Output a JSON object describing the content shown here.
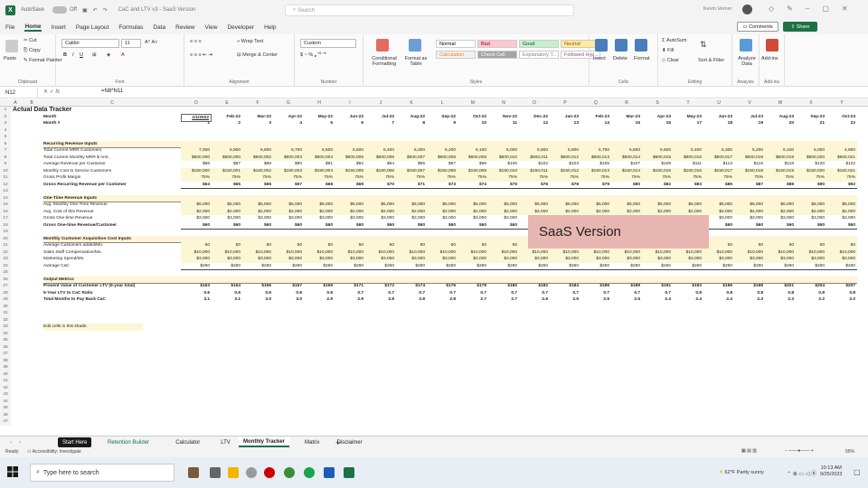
{
  "titlebar": {
    "autosave": "AutoSave",
    "autosave_state": "Off",
    "filename": "CaC and LTV v3 - SaaS Version",
    "search_placeholder": "Search",
    "user_name": "Kevin Verner"
  },
  "menu": [
    "File",
    "Home",
    "Insert",
    "Page Layout",
    "Formulas",
    "Data",
    "Review",
    "View",
    "Developer",
    "Help"
  ],
  "menu_active": "Home",
  "buttons": {
    "comments": "Comments",
    "share": "Share"
  },
  "ribbon": {
    "clipboard": {
      "paste": "Paste",
      "cut": "Cut",
      "copy": "Copy",
      "format_painter": "Format Painter",
      "label": "Clipboard"
    },
    "font": {
      "name": "Calibri",
      "size": "11",
      "label": "Font"
    },
    "alignment": {
      "wrap": "Wrap Text",
      "merge": "Merge & Center",
      "label": "Alignment"
    },
    "number": {
      "format": "Custom",
      "label": "Number"
    },
    "styles": {
      "cond": "Conditional Formatting",
      "table": "Format as Table",
      "label": "Styles",
      "cells": [
        {
          "t": "Normal",
          "bg": "#ffffff",
          "fg": "#000000"
        },
        {
          "t": "Bad",
          "bg": "#ffc7ce",
          "fg": "#9c0006"
        },
        {
          "t": "Good",
          "bg": "#c6efce",
          "fg": "#006100"
        },
        {
          "t": "Neutral",
          "bg": "#ffeb9c",
          "fg": "#9c5700"
        },
        {
          "t": "Calculation",
          "bg": "#f2f2f2",
          "fg": "#fa7d00"
        },
        {
          "t": "Check Cell",
          "bg": "#a5a5a5",
          "fg": "#ffffff"
        },
        {
          "t": "Explanatory T...",
          "bg": "#ffffff",
          "fg": "#7f7f7f"
        },
        {
          "t": "Followed Hyp...",
          "bg": "#ffffff",
          "fg": "#954f72"
        }
      ]
    },
    "cells": {
      "insert": "Insert",
      "delete": "Delete",
      "format": "Format",
      "label": "Cells"
    },
    "editing": {
      "autosum": "AutoSum",
      "fill": "Fill",
      "clear": "Clear",
      "sort": "Sort & Filter",
      "find": "Find & Select",
      "label": "Editing"
    },
    "analysis": {
      "analyze": "Analyze Data",
      "label": "Analysis"
    },
    "addins": {
      "addins": "Add-ins",
      "label": "Add-ins"
    }
  },
  "formula_bar": {
    "cell": "N12",
    "formula": "=N8*N11",
    "fx": "fx"
  },
  "columns": [
    "A",
    "B",
    "C",
    "D",
    "E",
    "F",
    "G",
    "H",
    "I",
    "J",
    "K",
    "L",
    "M",
    "N",
    "O",
    "P",
    "Q",
    "R",
    "S",
    "T",
    "U",
    "V",
    "W",
    "X",
    "Y"
  ],
  "sheet": {
    "title": "Actual Data Tracker",
    "months": [
      "1/1/2022",
      "Feb-22",
      "Mar-22",
      "Apr-22",
      "May-22",
      "Jun-22",
      "Jul-22",
      "Aug-22",
      "Sep-22",
      "Oct-22",
      "Nov-22",
      "Dec-22",
      "Jan-23",
      "Feb-23",
      "Mar-23",
      "Apr-23",
      "May-23",
      "Jun-23",
      "Jul-23",
      "Aug-23",
      "Sep-23",
      "Oct-23"
    ],
    "month_nums": [
      "1",
      "2",
      "3",
      "4",
      "5",
      "6",
      "7",
      "8",
      "9",
      "10",
      "11",
      "12",
      "13",
      "14",
      "15",
      "16",
      "17",
      "18",
      "19",
      "20",
      "21",
      "22"
    ],
    "rows": [
      {
        "r": "1",
        "label": "Actual Data Tracker",
        "style": "title"
      },
      {
        "r": "2",
        "label": "Month",
        "style": "bold",
        "key": "months"
      },
      {
        "r": "3",
        "label": "Month #",
        "style": "bold",
        "key": "month_nums"
      },
      {
        "r": "4"
      },
      {
        "r": "5"
      },
      {
        "r": "6",
        "label": "Recurring Revenue Inputs",
        "style": "section"
      },
      {
        "r": "7",
        "label": "Total Current MRR Customers",
        "vals": [
          "7,000",
          "6,900",
          "6,800",
          "6,700",
          "6,600",
          "6,500",
          "6,400",
          "6,300",
          "6,200",
          "6,100",
          "6,000",
          "5,900",
          "5,800",
          "5,700",
          "5,600",
          "5,500",
          "5,400",
          "5,300",
          "5,200",
          "5,100",
          "5,000",
          "4,900"
        ]
      },
      {
        "r": "8",
        "label": "Total Current Monthly MRR $ Amt.",
        "vals": [
          "$600,000",
          "$600,000",
          "$600,002",
          "$600,003",
          "$600,004",
          "$600,005",
          "$600,006",
          "$600,007",
          "$600,008",
          "$600,009",
          "$600,010",
          "$600,011",
          "$600,012",
          "$600,013",
          "$600,014",
          "$600,015",
          "$600,016",
          "$600,017",
          "$600,018",
          "$600,019",
          "$600,020",
          "$600,021"
        ]
      },
      {
        "r": "9",
        "label": "Average Revenue per Customer",
        "vals": [
          "$86",
          "$87",
          "$88",
          "$90",
          "$91",
          "$92",
          "$94",
          "$95",
          "$97",
          "$98",
          "$100",
          "$102",
          "$103",
          "$105",
          "$107",
          "$109",
          "$111",
          "$113",
          "$115",
          "$118",
          "$120",
          "$122"
        ]
      },
      {
        "r": "10",
        "label": "Monthly Cost to Service Customers",
        "vals": [
          "$150,000",
          "$150,001",
          "$150,002",
          "$150,003",
          "$150,004",
          "$150,005",
          "$150,006",
          "$150,007",
          "$150,008",
          "$150,009",
          "$150,010",
          "$150,011",
          "$150,012",
          "$150,013",
          "$150,014",
          "$150,015",
          "$150,016",
          "$150,017",
          "$150,018",
          "$150,019",
          "$150,020",
          "$150,021"
        ]
      },
      {
        "r": "11",
        "label": "Gross Profit Margin",
        "vals": [
          "75%",
          "75%",
          "75%",
          "75%",
          "75%",
          "75%",
          "75%",
          "75%",
          "75%",
          "75%",
          "75%",
          "75%",
          "75%",
          "75%",
          "75%",
          "75%",
          "75%",
          "75%",
          "75%",
          "75%",
          "75%",
          "75%"
        ]
      },
      {
        "r": "12",
        "label": "Gross Recurring Revenue per Customer",
        "style": "bold",
        "vals": [
          "$64",
          "$65",
          "$66",
          "$67",
          "$68",
          "$69",
          "$70",
          "$71",
          "$73",
          "$74",
          "$75",
          "$76",
          "$78",
          "$79",
          "$80",
          "$82",
          "$83",
          "$85",
          "$87",
          "$88",
          "$90",
          "$92"
        ]
      },
      {
        "r": "13"
      },
      {
        "r": "14",
        "label": "One-Time Revenue Inputs",
        "style": "section"
      },
      {
        "r": "15",
        "label": "Avg. Monthly One-Time Revenue",
        "vals": [
          "$5,000",
          "$5,000",
          "$5,000",
          "$5,000",
          "$5,000",
          "$5,000",
          "$5,000",
          "$5,000",
          "$5,000",
          "$5,000",
          "$5,000",
          "$5,000",
          "$5,000",
          "$5,000",
          "$5,000",
          "$5,000",
          "$5,000",
          "$5,000",
          "$5,000",
          "$5,000",
          "$5,000",
          "$5,000"
        ]
      },
      {
        "r": "16",
        "label": "Avg. Cost of this Revenue",
        "vals": [
          "$2,000",
          "$2,000",
          "$2,000",
          "$2,000",
          "$2,000",
          "$2,000",
          "$2,000",
          "$2,000",
          "$2,000",
          "$2,000",
          "$2,000",
          "$2,000",
          "$2,000",
          "$2,000",
          "$2,000",
          "$2,000",
          "$2,000",
          "$2,000",
          "$2,000",
          "$2,000",
          "$2,000",
          "$2,000"
        ]
      },
      {
        "r": "17",
        "label": "Gross One-time Revenue",
        "vals": [
          "$3,000",
          "$3,000",
          "$3,000",
          "$3,000",
          "$3,000",
          "$3,000",
          "$3,000",
          "$3,000",
          "$3,000",
          "$3,000",
          "$3,000",
          "$3,000",
          "$3,000",
          "$3,000",
          "$3,000",
          "$3,000",
          "$3,000",
          "$3,000",
          "$3,000",
          "$3,000",
          "$3,000",
          "$3,000"
        ]
      },
      {
        "r": "18",
        "label": "Gross One-time Revenue/Customer",
        "style": "bold",
        "vals": [
          "$60",
          "$60",
          "$60",
          "$60",
          "$60",
          "$60",
          "$60",
          "$60",
          "$60",
          "$60",
          "$60",
          "$60",
          "$60",
          "$60",
          "$60",
          "$60",
          "$60",
          "$60",
          "$60",
          "$60",
          "$60",
          "$60"
        ]
      },
      {
        "r": "19"
      },
      {
        "r": "20",
        "label": "Monthly Customer Acquisition Cost Inputs",
        "style": "section"
      },
      {
        "r": "21",
        "label": "Average Customers added/Mo.",
        "vals": [
          "50",
          "50",
          "50",
          "50",
          "50",
          "50",
          "50",
          "50",
          "50",
          "50",
          "50",
          "50",
          "50",
          "50",
          "50",
          "50",
          "50",
          "50",
          "50",
          "50",
          "50",
          "50"
        ]
      },
      {
        "r": "22",
        "label": "Sales Staff Compensation/Mo.",
        "vals": [
          "$10,000",
          "$10,000",
          "$10,000",
          "$10,000",
          "$10,000",
          "$10,000",
          "$10,000",
          "$10,000",
          "$10,000",
          "$10,000",
          "$10,000",
          "$10,000",
          "$10,000",
          "$10,000",
          "$10,000",
          "$10,000",
          "$10,000",
          "$10,000",
          "$10,000",
          "$10,000",
          "$10,000",
          "$10,000"
        ]
      },
      {
        "r": "23",
        "label": "Marketing Spend/Mo.",
        "vals": [
          "$3,000",
          "$3,000",
          "$3,000",
          "$3,000",
          "$3,000",
          "$3,000",
          "$3,000",
          "$3,000",
          "$3,000",
          "$3,000",
          "$3,000",
          "$3,000",
          "$3,000",
          "$3,000",
          "$3,000",
          "$3,000",
          "$3,000",
          "$3,000",
          "$3,000",
          "$3,000",
          "$3,000",
          "$3,000"
        ]
      },
      {
        "r": "24",
        "label": "Average CaC",
        "vals": [
          "$260",
          "$260",
          "$260",
          "$260",
          "$260",
          "$260",
          "$260",
          "$260",
          "$260",
          "$260",
          "$260",
          "$260",
          "$260",
          "$260",
          "$260",
          "$260",
          "$260",
          "$260",
          "$260",
          "$260",
          "$260",
          "$260"
        ]
      },
      {
        "r": "25"
      },
      {
        "r": "26",
        "label": "Output Metrics",
        "style": "section"
      },
      {
        "r": "27",
        "label": "Present Value of Customer LTV (5-year total)",
        "style": "bold",
        "vals": [
          "$163",
          "$164",
          "$166",
          "$167",
          "$169",
          "$171",
          "$172",
          "$174",
          "$176",
          "$178",
          "$180",
          "$182",
          "$184",
          "$186",
          "$189",
          "$191",
          "$193",
          "$196",
          "$198",
          "$201",
          "$204",
          "$207"
        ]
      },
      {
        "r": "28",
        "label": "5-Year LTV to CaC Ratio",
        "style": "bold",
        "vals": [
          "0.6",
          "0.6",
          "0.6",
          "0.6",
          "0.6",
          "0.7",
          "0.7",
          "0.7",
          "0.7",
          "0.7",
          "0.7",
          "0.7",
          "0.7",
          "0.7",
          "0.7",
          "0.7",
          "0.8",
          "0.8",
          "0.8",
          "0.8",
          "0.8",
          "0.8"
        ]
      },
      {
        "r": "29",
        "label": "Total Months to Pay Back CaC",
        "style": "bold",
        "vals": [
          "3.1",
          "3.1",
          "3.0",
          "3.0",
          "2.9",
          "2.9",
          "2.8",
          "2.8",
          "2.8",
          "2.7",
          "2.7",
          "2.6",
          "2.6",
          "2.5",
          "2.5",
          "2.4",
          "2.4",
          "2.4",
          "2.3",
          "2.3",
          "2.2",
          "2.2"
        ]
      },
      {
        "r": "30"
      },
      {
        "r": "31"
      },
      {
        "r": "32"
      },
      {
        "r": "33",
        "label": "Edit cells in this shade.",
        "style": "note"
      },
      {
        "r": "34"
      },
      {
        "r": "35"
      },
      {
        "r": "36"
      },
      {
        "r": "37"
      },
      {
        "r": "38"
      },
      {
        "r": "39"
      },
      {
        "r": "40"
      },
      {
        "r": "41"
      },
      {
        "r": "42"
      },
      {
        "r": "43"
      },
      {
        "r": "44"
      },
      {
        "r": "45"
      },
      {
        "r": "46"
      },
      {
        "r": "47"
      }
    ]
  },
  "overlay": "SaaS Version",
  "tabs": [
    {
      "t": "Start Here",
      "style": "dark"
    },
    {
      "t": "Retention Builder",
      "style": "green"
    },
    {
      "t": "Calculator",
      "style": ""
    },
    {
      "t": "LTV",
      "style": ""
    },
    {
      "t": "Monthly Tracker",
      "style": "active"
    },
    {
      "t": "Matrix",
      "style": ""
    },
    {
      "t": "Disclaimer",
      "style": ""
    }
  ],
  "status": {
    "ready": "Ready",
    "accessibility": "Accessibility: Investigate",
    "zoom": "55%"
  },
  "taskbar": {
    "search": "Type here to search",
    "weather": "62°F Partly sunny",
    "time": "10:13 AM",
    "date": "9/25/2023"
  },
  "colors": {
    "excel_green": "#1e7145",
    "section_fill": "#fff4d6",
    "input_fill": "#fbf7d4",
    "overlay": "#e8b6b0"
  }
}
